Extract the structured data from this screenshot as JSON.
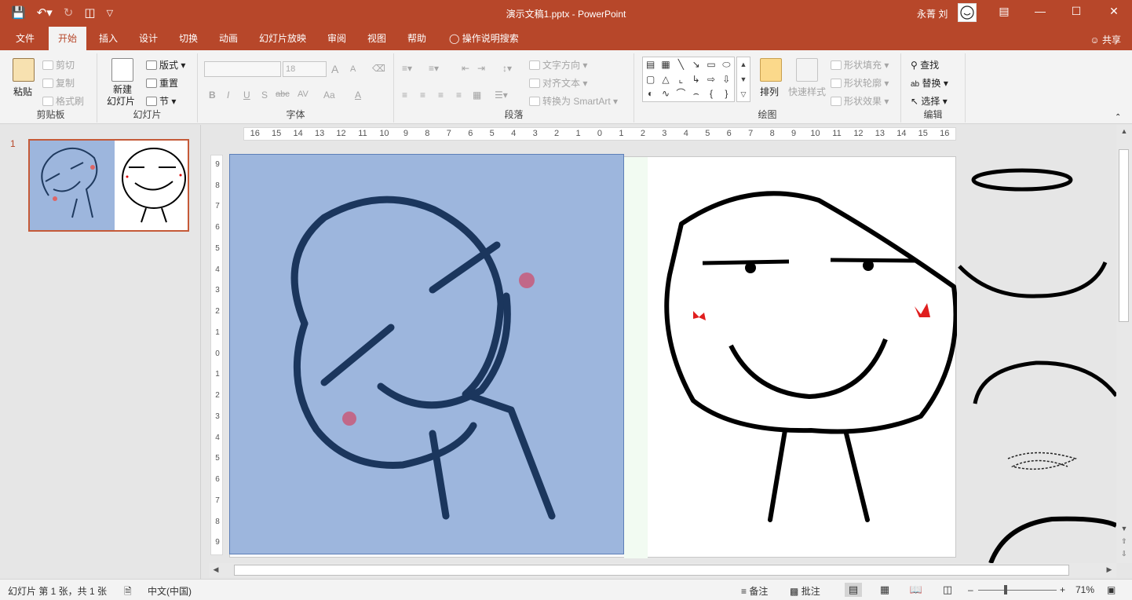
{
  "window": {
    "title": "演示文稿1.pptx  -  PowerPoint",
    "user_name": "永菁 刘",
    "brand_color": "#b7472a"
  },
  "quick_access": {
    "save_icon": "save-icon",
    "undo_icon": "undo-icon",
    "redo_icon": "redo-icon",
    "start_from_beginning_icon": "slideshow-start-icon",
    "customize_icon": "customize-qat-icon"
  },
  "tabs": [
    {
      "label": "文件"
    },
    {
      "label": "开始"
    },
    {
      "label": "插入"
    },
    {
      "label": "设计"
    },
    {
      "label": "切换"
    },
    {
      "label": "动画"
    },
    {
      "label": "幻灯片放映"
    },
    {
      "label": "审阅"
    },
    {
      "label": "视图"
    },
    {
      "label": "帮助"
    },
    {
      "label": "操作说明搜索"
    }
  ],
  "share_label": "共享",
  "ribbon": {
    "clipboard": {
      "label": "剪贴板",
      "paste": "粘贴",
      "cut": "剪切",
      "copy": "复制",
      "format_painter": "格式刷"
    },
    "slides": {
      "label": "幻灯片",
      "new_slide_line1": "新建",
      "new_slide_line2": "幻灯片",
      "layout": "版式",
      "reset": "重置",
      "section": "节"
    },
    "font": {
      "label": "字体",
      "font_size": "18",
      "bold": "B",
      "italic": "I",
      "underline": "U",
      "shadow": "S",
      "strikethrough": "abc",
      "spacing": "AV",
      "case": "Aa",
      "color": "A",
      "grow": "A",
      "shrink": "A"
    },
    "paragraph": {
      "label": "段落",
      "text_direction": "文字方向",
      "align_text": "对齐文本",
      "smartart": "转换为 SmartArt"
    },
    "drawing": {
      "label": "绘图",
      "arrange": "排列",
      "quick_styles": "快速样式",
      "shape_fill": "形状填充",
      "shape_outline": "形状轮廓",
      "shape_effects": "形状效果"
    },
    "editing": {
      "label": "编辑",
      "find": "查找",
      "replace": "替换",
      "select": "选择"
    }
  },
  "thumbnail": {
    "slide_number": "1"
  },
  "ruler": {
    "h_ticks": [
      "16",
      "15",
      "14",
      "13",
      "12",
      "11",
      "10",
      "9",
      "8",
      "7",
      "6",
      "5",
      "4",
      "3",
      "2",
      "1",
      "0",
      "1",
      "2",
      "3",
      "4",
      "5",
      "6",
      "7",
      "8",
      "9",
      "10",
      "11",
      "12",
      "13",
      "14",
      "15",
      "16"
    ],
    "v_ticks": [
      "9",
      "8",
      "7",
      "6",
      "5",
      "4",
      "3",
      "2",
      "1",
      "0",
      "1",
      "2",
      "3",
      "4",
      "5",
      "6",
      "7",
      "8",
      "9"
    ]
  },
  "statusbar": {
    "slide_info": "幻灯片 第 1 张，共 1 张",
    "language": "中文(中国)",
    "notes": "备注",
    "comments": "批注",
    "zoom": "71%"
  }
}
